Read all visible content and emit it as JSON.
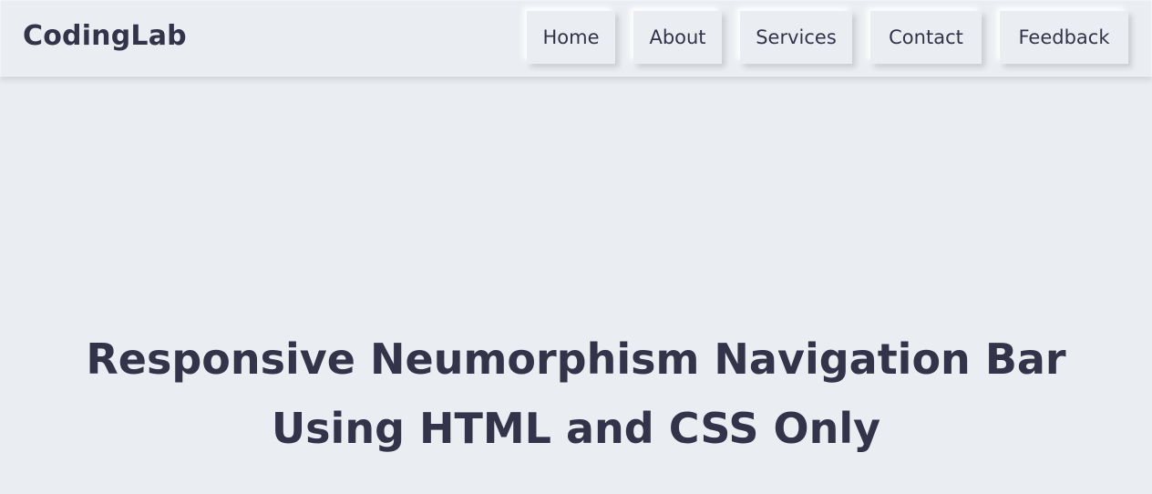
{
  "brand": {
    "name": "CodingLab"
  },
  "nav": {
    "items": [
      {
        "label": "Home"
      },
      {
        "label": "About"
      },
      {
        "label": "Services"
      },
      {
        "label": "Contact"
      },
      {
        "label": "Feedback"
      }
    ]
  },
  "hero": {
    "line1": "Responsive Neumorphism Navigation Bar",
    "line2": "Using HTML and CSS Only"
  },
  "colors": {
    "background": "#eaeef2",
    "text": "#33334a"
  }
}
